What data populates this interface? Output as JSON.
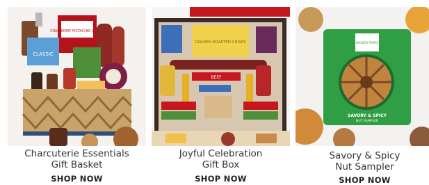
{
  "products": [
    {
      "title_line1": "Charcuterie Essentials",
      "title_line2": "Gift Basket",
      "cta": "SHOP NOW",
      "image": "charcuterie-basket-image"
    },
    {
      "title_line1": "Joyful Celebration",
      "title_line2": "Gift Box",
      "cta": "SHOP NOW",
      "image": "celebration-box-image"
    },
    {
      "title_line1": "Savory & Spicy",
      "title_line2": "Nut Sampler",
      "cta": "SHOP NOW",
      "image": "nut-sampler-image"
    }
  ],
  "package_text": {
    "basket_label1": "CRANBERRY PISTACHIO CRISPS",
    "basket_label2": "CLASSIC",
    "box_label": "GOLDEN ROASTED CRISPS",
    "box_beef": "BEEF",
    "nut_tin_brand": "HICKORY FARMS",
    "nut_tin_title": "SAVORY & SPICY",
    "nut_tin_sub": "NUT SAMPLER"
  },
  "colors": {
    "accent_red": "#b5121b",
    "tin_green": "#2f9e45",
    "basket_tan": "#c9a36a"
  }
}
